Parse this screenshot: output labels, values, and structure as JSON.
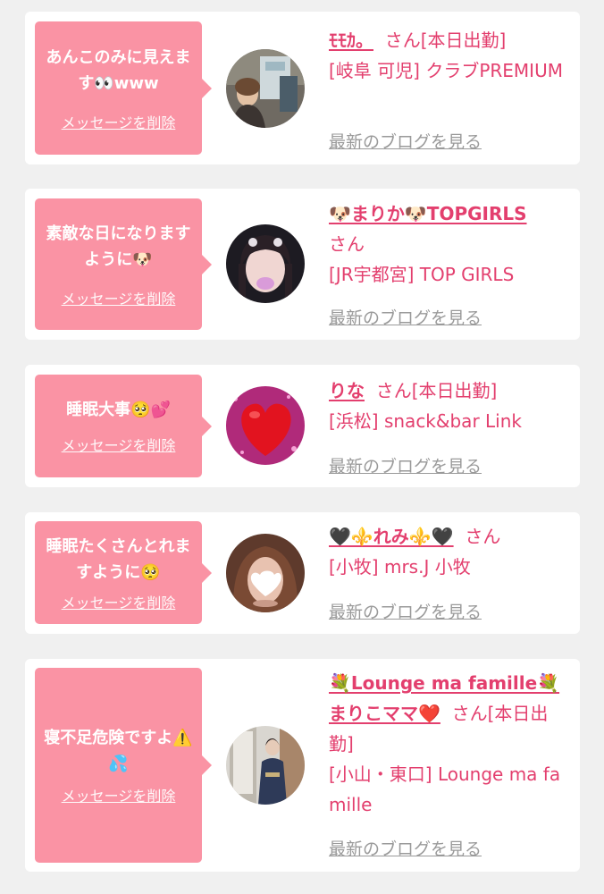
{
  "colors": {
    "background": "#f0f0f0",
    "card": "#ffffff",
    "bubble": "#fa93a4",
    "accent": "#e33f6e",
    "blog_link": "#9a9a9a"
  },
  "delete_label": "メッセージを削除",
  "blog_label": "最新のブログを見る",
  "items": [
    {
      "message": "あんこのみに見えます👀www",
      "name": "ﾓﾓｶ。",
      "suffix": "さん[本日出勤]",
      "shop": "[岐阜 可児] クラブPREMIUM",
      "avatar_icon": "photo-avatar-icon"
    },
    {
      "message": "素敵な日になりますように🐶",
      "name": "🐶まりか🐶TOPGIRLS",
      "suffix": "さん",
      "shop": "[JR宇都宮] TOP GIRLS",
      "avatar_icon": "photo-avatar-icon"
    },
    {
      "message": "睡眠大事🥺💕",
      "name": "りな",
      "suffix": "さん[本日出勤]",
      "shop": "[浜松] snack&bar Link",
      "avatar_icon": "heart-avatar-icon"
    },
    {
      "message": "睡眠たくさんとれますように🥺",
      "name": "🖤⚜️れみ⚜️🖤",
      "suffix": "さん",
      "shop": "[小牧] mrs.J 小牧",
      "avatar_icon": "photo-avatar-icon"
    },
    {
      "message": "寝不足危険ですよ⚠️💦",
      "name": "💐Lounge ma famille💐まりこママ❤️",
      "suffix": "さん[本日出勤]",
      "shop": "[小山・東口] Lounge ma famille",
      "avatar_icon": "photo-avatar-icon"
    }
  ]
}
